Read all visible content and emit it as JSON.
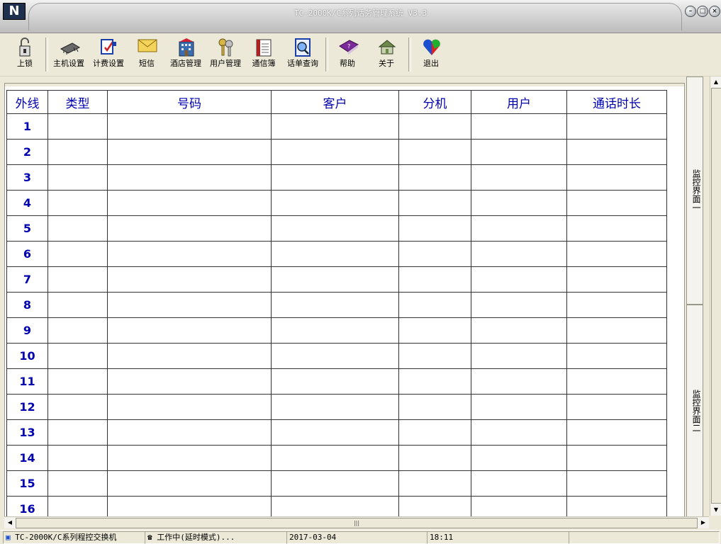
{
  "window": {
    "title": "TC-2000K/C系列话务管理系统 V3.3",
    "logo": "N"
  },
  "toolbar": {
    "items": [
      {
        "label": "上锁",
        "icon": "lock-icon"
      },
      {
        "label": "主机设置",
        "icon": "chip-icon"
      },
      {
        "label": "计费设置",
        "icon": "billing-icon"
      },
      {
        "label": "短信",
        "icon": "envelope-icon"
      },
      {
        "label": "酒店管理",
        "icon": "hotel-icon"
      },
      {
        "label": "用户管理",
        "icon": "keys-icon"
      },
      {
        "label": "通信簿",
        "icon": "phonebook-icon"
      },
      {
        "label": "话单查询",
        "icon": "query-icon"
      },
      {
        "label": "帮助",
        "icon": "help-book-icon"
      },
      {
        "label": "关于",
        "icon": "about-house-icon"
      },
      {
        "label": "退出",
        "icon": "exit-heart-icon"
      }
    ]
  },
  "grid": {
    "headers": [
      "外线",
      "类型",
      "号码",
      "客户",
      "分机",
      "用户",
      "通话时长"
    ],
    "rows": [
      "1",
      "2",
      "3",
      "4",
      "5",
      "6",
      "7",
      "8",
      "9",
      "10",
      "11",
      "12",
      "13",
      "14",
      "15",
      "16"
    ]
  },
  "side_tabs": [
    "监控界面一",
    "监控界面二"
  ],
  "statusbar": {
    "product": "TC-2000K/C系列程控交换机",
    "status": "工作中(延时模式)...",
    "date": "2017-03-04",
    "time": "18:11"
  },
  "colors": {
    "header_text": "#0000b0",
    "title_bg": "#c4c4c4"
  }
}
